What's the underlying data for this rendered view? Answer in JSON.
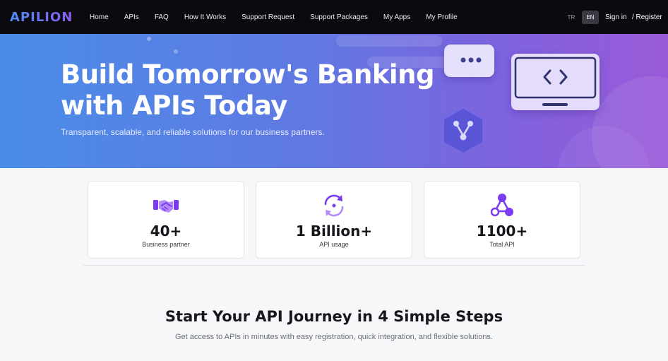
{
  "brand": {
    "logo": "APILION"
  },
  "nav": {
    "items": [
      {
        "label": "Home"
      },
      {
        "label": "APIs"
      },
      {
        "label": "FAQ"
      },
      {
        "label": "How It Works"
      },
      {
        "label": "Support Request"
      },
      {
        "label": "Support Packages"
      },
      {
        "label": "My Apps"
      },
      {
        "label": "My Profile"
      }
    ],
    "lang_tr": "TR",
    "lang_en": "EN",
    "sign_in": "Sign in",
    "register": "/ Register"
  },
  "hero": {
    "title": "Build Tomorrow's Banking with APIs Today",
    "subtitle": "Transparent, scalable, and reliable solutions for our business partners.",
    "icons": [
      "chat-dots-icon",
      "hexagon-branch-icon",
      "monitor-code-icon"
    ]
  },
  "stats": [
    {
      "icon": "handshake-icon",
      "value": "40+",
      "label": "Business partner"
    },
    {
      "icon": "refresh-cycle-icon",
      "value": "1 Billion+",
      "label": "API usage"
    },
    {
      "icon": "network-nodes-icon",
      "value": "1100+",
      "label": "Total API"
    }
  ],
  "steps": {
    "title": "Start Your API Journey in 4 Simple Steps",
    "subtitle": "Get access to APIs in minutes with easy registration, quick integration, and flexible solutions."
  },
  "colors": {
    "accent": "#7a3cf0",
    "nav_bg": "#0b0b0f",
    "hero_start": "#4a8de8",
    "hero_end": "#9a5ad8"
  }
}
